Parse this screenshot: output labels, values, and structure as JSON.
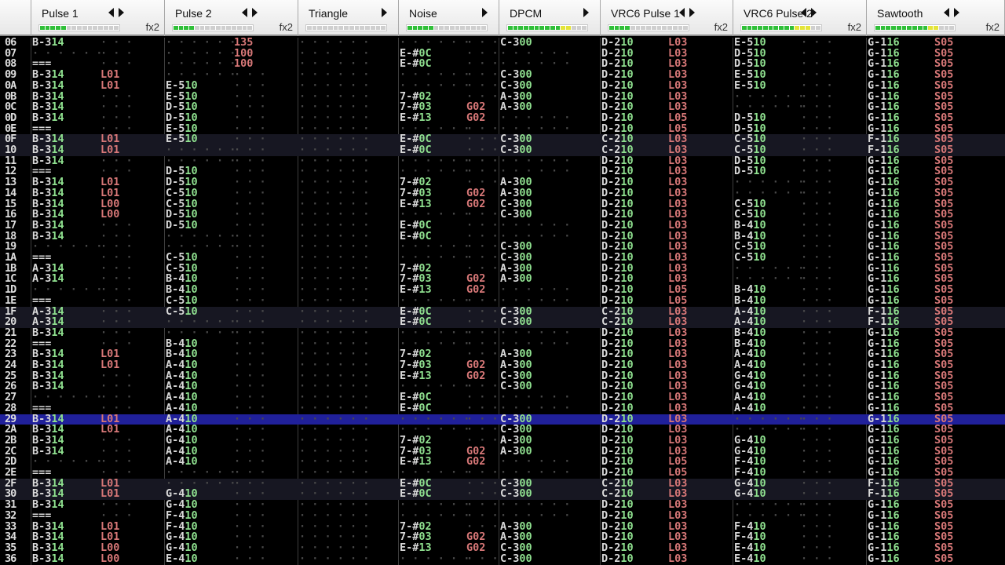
{
  "channels": [
    {
      "name": "Pulse 1",
      "fx": "fx2",
      "meter": 5
    },
    {
      "name": "Pulse 2",
      "fx": "fx2",
      "meter": 4
    },
    {
      "name": "Triangle",
      "fx": "",
      "meter": 0
    },
    {
      "name": "Noise",
      "fx": "",
      "meter": 5
    },
    {
      "name": "DPCM",
      "fx": "",
      "meter": 12
    },
    {
      "name": "VRC6 Pulse 1",
      "fx": "fx2",
      "meter": 4
    },
    {
      "name": "VRC6 Pulse 2",
      "fx": "fx2",
      "meter": 13
    },
    {
      "name": "Sawtooth",
      "fx": "fx2",
      "meter": 12
    }
  ],
  "current_row": "29",
  "rows": [
    {
      "r": "06",
      "p1": "B-3 14",
      "p2e": "135",
      "dp": "C-3 00",
      "v1": "D-2 10",
      "v1e": "L03",
      "v2": "E-5 10",
      "sw": "G-1 16",
      "swe": "S05"
    },
    {
      "r": "07",
      "p2e": "100",
      "no": "E-# 0C",
      "v1": "D-2 10",
      "v1e": "L03",
      "v2": "D-5 10",
      "sw": "G-1 16",
      "swe": "S05"
    },
    {
      "r": "08",
      "p1": "===",
      "p2e": "100",
      "no": "E-# 0C",
      "v1": "D-2 10",
      "v1e": "L03",
      "v2": "D-5 10",
      "sw": "G-1 16",
      "swe": "S05"
    },
    {
      "r": "09",
      "p1": "B-3 14",
      "p1e": "L01",
      "dp": "C-3 00",
      "v1": "D-2 10",
      "v1e": "L03",
      "v2": "E-5 10",
      "sw": "G-1 16",
      "swe": "S05"
    },
    {
      "r": "0A",
      "p1": "B-3 14",
      "p1e": "L01",
      "p2": "E-5 10",
      "dp": "C-3 00",
      "v1": "D-2 10",
      "v1e": "L03",
      "v2": "E-5 10",
      "sw": "G-1 16",
      "swe": "S05"
    },
    {
      "r": "0B",
      "p1": "B-3 14",
      "p2": "E-5 10",
      "no": "7-# 02",
      "dp": "A-3 00",
      "v1": "D-2 10",
      "v1e": "L03",
      "sw": "G-1 16",
      "swe": "S05"
    },
    {
      "r": "0C",
      "p1": "B-3 14",
      "p2": "D-5 10",
      "no": "7-# 03",
      "noe": "G02",
      "dp": "A-3 00",
      "v1": "D-2 10",
      "v1e": "L03",
      "sw": "G-1 16",
      "swe": "S05"
    },
    {
      "r": "0D",
      "p1": "B-3 14",
      "p2": "D-5 10",
      "no": "E-# 13",
      "noe": "G02",
      "v1": "D-2 10",
      "v1e": "L05",
      "v2": "D-5 10",
      "sw": "G-1 16",
      "swe": "S05"
    },
    {
      "r": "0E",
      "p1": "===",
      "p2": "E-5 10",
      "v1": "D-2 10",
      "v1e": "L05",
      "v2": "D-5 10",
      "sw": "G-1 16",
      "swe": "S05"
    },
    {
      "r": "0F",
      "p1": "B-3 14",
      "p1e": "L01",
      "p2": "E-5 10",
      "no": "E-# 0C",
      "dp": "C-3 00",
      "v1": "C-2 10",
      "v1e": "L03",
      "v2": "C-5 10",
      "sw": "F-1 16",
      "swe": "S05"
    },
    {
      "r": "10",
      "p1": "B-3 14",
      "p1e": "L01",
      "no": "E-# 0C",
      "dp": "C-3 00",
      "v1": "C-2 10",
      "v1e": "L03",
      "v2": "C-5 10",
      "sw": "F-1 16",
      "swe": "S05"
    },
    {
      "r": "11",
      "p1": "B-3 14",
      "v1": "D-2 10",
      "v1e": "L03",
      "v2": "D-5 10",
      "sw": "G-1 16",
      "swe": "S05"
    },
    {
      "r": "12",
      "p1": "===",
      "p2": "D-5 10",
      "v1": "D-2 10",
      "v1e": "L03",
      "v2": "D-5 10",
      "sw": "G-1 16",
      "swe": "S05"
    },
    {
      "r": "13",
      "p1": "B-3 14",
      "p1e": "L01",
      "p2": "D-5 10",
      "no": "7-# 02",
      "dp": "A-3 00",
      "v1": "D-2 10",
      "v1e": "L03",
      "sw": "G-1 16",
      "swe": "S05"
    },
    {
      "r": "14",
      "p1": "B-3 14",
      "p1e": "L01",
      "p2": "C-5 10",
      "no": "7-# 03",
      "noe": "G02",
      "dp": "A-3 00",
      "v1": "D-2 10",
      "v1e": "L03",
      "sw": "G-1 16",
      "swe": "S05"
    },
    {
      "r": "15",
      "p1": "B-3 14",
      "p1e": "L00",
      "p2": "C-5 10",
      "no": "E-# 13",
      "noe": "G02",
      "dp": "C-3 00",
      "v1": "D-2 10",
      "v1e": "L03",
      "v2": "C-5 10",
      "sw": "G-1 16",
      "swe": "S05"
    },
    {
      "r": "16",
      "p1": "B-3 14",
      "p1e": "L00",
      "p2": "D-5 10",
      "dp": "C-3 00",
      "v1": "D-2 10",
      "v1e": "L03",
      "v2": "C-5 10",
      "sw": "G-1 16",
      "swe": "S05"
    },
    {
      "r": "17",
      "p1": "B-3 14",
      "p2": "D-5 10",
      "no": "E-# 0C",
      "v1": "D-2 10",
      "v1e": "L03",
      "v2": "B-4 10",
      "sw": "G-1 16",
      "swe": "S05"
    },
    {
      "r": "18",
      "p1": "B-3 14",
      "no": "E-# 0C",
      "v1": "D-2 10",
      "v1e": "L03",
      "v2": "B-4 10",
      "sw": "G-1 16",
      "swe": "S05"
    },
    {
      "r": "19",
      "dp": "C-3 00",
      "v1": "D-2 10",
      "v1e": "L03",
      "v2": "C-5 10",
      "sw": "G-1 16",
      "swe": "S05"
    },
    {
      "r": "1A",
      "p1": "===",
      "p2": "C-5 10",
      "dp": "C-3 00",
      "v1": "D-2 10",
      "v1e": "L03",
      "v2": "C-5 10",
      "sw": "G-1 16",
      "swe": "S05"
    },
    {
      "r": "1B",
      "p1": "A-3 14",
      "p2": "C-5 10",
      "no": "7-# 02",
      "dp": "A-3 00",
      "v1": "D-2 10",
      "v1e": "L03",
      "sw": "G-1 16",
      "swe": "S05"
    },
    {
      "r": "1C",
      "p1": "A-3 14",
      "p2": "B-4 10",
      "no": "7-# 03",
      "noe": "G02",
      "dp": "A-3 00",
      "v1": "D-2 10",
      "v1e": "L03",
      "sw": "G-1 16",
      "swe": "S05"
    },
    {
      "r": "1D",
      "p2": "B-4 10",
      "no": "E-# 13",
      "noe": "G02",
      "v1": "D-2 10",
      "v1e": "L05",
      "v2": "B-4 10",
      "sw": "G-1 16",
      "swe": "S05"
    },
    {
      "r": "1E",
      "p1": "===",
      "p2": "C-5 10",
      "v1": "D-2 10",
      "v1e": "L05",
      "v2": "B-4 10",
      "sw": "G-1 16",
      "swe": "S05"
    },
    {
      "r": "1F",
      "p1": "A-3 14",
      "p2": "C-5 10",
      "no": "E-# 0C",
      "dp": "C-3 00",
      "v1": "C-2 10",
      "v1e": "L03",
      "v2": "A-4 10",
      "sw": "F-1 16",
      "swe": "S05"
    },
    {
      "r": "20",
      "p1": "A-3 14",
      "no": "E-# 0C",
      "dp": "C-3 00",
      "v1": "C-2 10",
      "v1e": "L03",
      "v2": "A-4 10",
      "sw": "F-1 16",
      "swe": "S05"
    },
    {
      "r": "21",
      "p1": "B-3 14",
      "v1": "D-2 10",
      "v1e": "L03",
      "v2": "B-4 10",
      "sw": "G-1 16",
      "swe": "S05"
    },
    {
      "r": "22",
      "p1": "===",
      "p2": "B-4 10",
      "v1": "D-2 10",
      "v1e": "L03",
      "v2": "B-4 10",
      "sw": "G-1 16",
      "swe": "S05"
    },
    {
      "r": "23",
      "p1": "B-3 14",
      "p1e": "L01",
      "p2": "B-4 10",
      "no": "7-# 02",
      "dp": "A-3 00",
      "v1": "D-2 10",
      "v1e": "L03",
      "v2": "A-4 10",
      "sw": "G-1 16",
      "swe": "S05"
    },
    {
      "r": "24",
      "p1": "B-3 14",
      "p1e": "L01",
      "p2": "A-4 10",
      "no": "7-# 03",
      "noe": "G02",
      "dp": "A-3 00",
      "v1": "D-2 10",
      "v1e": "L03",
      "v2": "A-4 10",
      "sw": "G-1 16",
      "swe": "S05"
    },
    {
      "r": "25",
      "p1": "B-3 14",
      "p2": "A-4 10",
      "no": "E-# 13",
      "noe": "G02",
      "dp": "C-3 00",
      "v1": "D-2 10",
      "v1e": "L03",
      "v2": "G-4 10",
      "sw": "G-1 16",
      "swe": "S05"
    },
    {
      "r": "26",
      "p1": "B-3 14",
      "p2": "A-4 10",
      "dp": "C-3 00",
      "v1": "D-2 10",
      "v1e": "L03",
      "v2": "G-4 10",
      "sw": "G-1 16",
      "swe": "S05"
    },
    {
      "r": "27",
      "p2": "A-4 10",
      "no": "E-# 0C",
      "v1": "D-2 10",
      "v1e": "L03",
      "v2": "A-4 10",
      "sw": "G-1 16",
      "swe": "S05"
    },
    {
      "r": "28",
      "p1": "===",
      "p2": "A-4 10",
      "no": "E-# 0C",
      "v1": "D-2 10",
      "v1e": "L03",
      "v2": "A-4 10",
      "sw": "G-1 16",
      "swe": "S05"
    },
    {
      "r": "29",
      "p1": "B-3 14",
      "p1e": "L01",
      "p2": "A-4 10",
      "dp": "C-3 00",
      "v1": "D-2 10",
      "v1e": "L03",
      "sw": "G-1 16",
      "swe": "S05"
    },
    {
      "r": "2A",
      "p1": "B-3 14",
      "p1e": "L01",
      "p2": "A-4 10",
      "dp": "C-3 00",
      "v1": "D-2 10",
      "v1e": "L03",
      "sw": "G-1 16",
      "swe": "S05"
    },
    {
      "r": "2B",
      "p1": "B-3 14",
      "p2": "G-4 10",
      "no": "7-# 02",
      "dp": "A-3 00",
      "v1": "D-2 10",
      "v1e": "L03",
      "v2": "G-4 10",
      "sw": "G-1 16",
      "swe": "S05"
    },
    {
      "r": "2C",
      "p1": "B-3 14",
      "p2": "A-4 10",
      "no": "7-# 03",
      "noe": "G02",
      "dp": "A-3 00",
      "v1": "D-2 10",
      "v1e": "L03",
      "v2": "G-4 10",
      "sw": "G-1 16",
      "swe": "S05"
    },
    {
      "r": "2D",
      "p2": "A-4 10",
      "no": "E-# 13",
      "noe": "G02",
      "v1": "D-2 10",
      "v1e": "L05",
      "v2": "F-4 10",
      "sw": "G-1 16",
      "swe": "S05"
    },
    {
      "r": "2E",
      "p1": "===",
      "v1": "D-2 10",
      "v1e": "L05",
      "v2": "F-4 10",
      "sw": "G-1 16",
      "swe": "S05"
    },
    {
      "r": "2F",
      "p1": "B-3 14",
      "p1e": "L01",
      "no": "E-# 0C",
      "dp": "C-3 00",
      "v1": "C-2 10",
      "v1e": "L03",
      "v2": "G-4 10",
      "sw": "F-1 16",
      "swe": "S05"
    },
    {
      "r": "30",
      "p1": "B-3 14",
      "p1e": "L01",
      "p2": "G-4 10",
      "no": "E-# 0C",
      "dp": "C-3 00",
      "v1": "C-2 10",
      "v1e": "L03",
      "v2": "G-4 10",
      "sw": "F-1 16",
      "swe": "S05"
    },
    {
      "r": "31",
      "p1": "B-3 14",
      "p2": "G-4 10",
      "v1": "D-2 10",
      "v1e": "L03",
      "sw": "G-1 16",
      "swe": "S05"
    },
    {
      "r": "32",
      "p1": "===",
      "p2": "F-4 10",
      "v1": "D-2 10",
      "v1e": "L03",
      "sw": "G-1 16",
      "swe": "S05"
    },
    {
      "r": "33",
      "p1": "B-3 14",
      "p1e": "L01",
      "p2": "F-4 10",
      "no": "7-# 02",
      "dp": "A-3 00",
      "v1": "D-2 10",
      "v1e": "L03",
      "v2": "F-4 10",
      "sw": "G-1 16",
      "swe": "S05"
    },
    {
      "r": "34",
      "p1": "B-3 14",
      "p1e": "L01",
      "p2": "G-4 10",
      "no": "7-# 03",
      "noe": "G02",
      "dp": "A-3 00",
      "v1": "D-2 10",
      "v1e": "L03",
      "v2": "F-4 10",
      "sw": "G-1 16",
      "swe": "S05"
    },
    {
      "r": "35",
      "p1": "B-3 14",
      "p1e": "L00",
      "p2": "G-4 10",
      "no": "E-# 13",
      "noe": "G02",
      "dp": "C-3 00",
      "v1": "D-2 10",
      "v1e": "L03",
      "v2": "E-4 10",
      "sw": "G-1 16",
      "swe": "S05"
    },
    {
      "r": "36",
      "p1": "B-3 14",
      "p1e": "L00",
      "p2": "E-4 10",
      "dp": "C-3 00",
      "v1": "D-2 10",
      "v1e": "L03",
      "v2": "E-4 10",
      "sw": "G-1 16",
      "swe": "S05"
    }
  ]
}
